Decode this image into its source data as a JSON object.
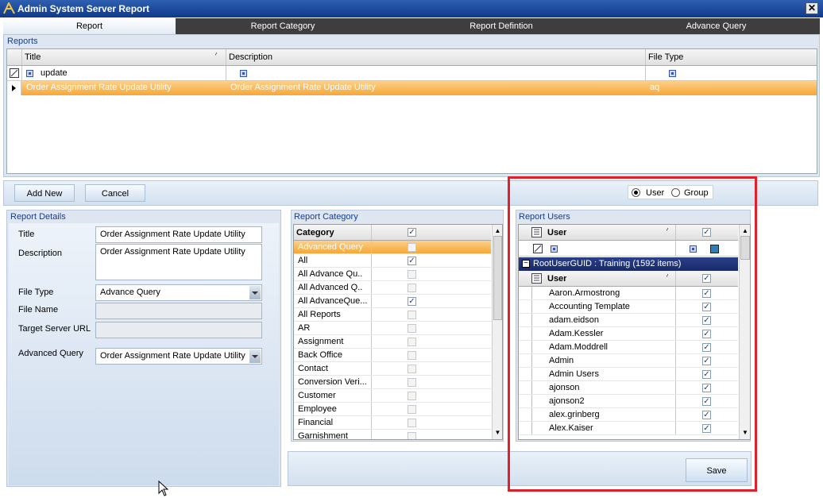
{
  "window": {
    "title": "Admin System Server Report",
    "close_glyph": "✕"
  },
  "tabs": [
    "Report",
    "Report Category",
    "Report Defintion",
    "Advance Query"
  ],
  "reports": {
    "section_title": "Reports",
    "columns": [
      "Title",
      "Description",
      "File Type"
    ],
    "filter_row": {
      "title": "update",
      "description": "",
      "file_type": ""
    },
    "rows": [
      {
        "title": "Order Assignment Rate Update Utility",
        "description": "Order Assignment Rate Update Utility",
        "file_type": "aq"
      }
    ]
  },
  "toolbar": {
    "add_new": "Add New",
    "cancel": "Cancel"
  },
  "mode": {
    "user_label": "User",
    "group_label": "Group",
    "selected": "User"
  },
  "report_details": {
    "section_title": "Report Details",
    "title_label": "Title",
    "title_value": "Order Assignment Rate Update Utility",
    "description_label": "Description",
    "description_value": "Order Assignment Rate Update Utility",
    "file_type_label": "File Type",
    "file_type_value": "Advance Query",
    "file_name_label": "File Name",
    "file_name_value": "",
    "target_url_label": "Target Server URL",
    "target_url_value": "",
    "advanced_query_label": "Advanced Query",
    "advanced_query_value": "Order Assignment Rate Update Utility"
  },
  "report_category": {
    "section_title": "Report Category",
    "column": "Category",
    "items": [
      {
        "name": "Advanced Query",
        "checked": false,
        "selected": true
      },
      {
        "name": "All",
        "checked": true
      },
      {
        "name": "All Advance Qu..",
        "checked": false
      },
      {
        "name": "All Advanced Q..",
        "checked": false
      },
      {
        "name": "All AdvanceQue...",
        "checked": true
      },
      {
        "name": "All Reports",
        "checked": false
      },
      {
        "name": "AR",
        "checked": false
      },
      {
        "name": "Assignment",
        "checked": false
      },
      {
        "name": "Back Office",
        "checked": false
      },
      {
        "name": "Contact",
        "checked": false
      },
      {
        "name": "Conversion Veri...",
        "checked": false
      },
      {
        "name": "Customer",
        "checked": false
      },
      {
        "name": "Employee",
        "checked": false
      },
      {
        "name": "Financial",
        "checked": false
      },
      {
        "name": "Garnishment",
        "checked": false
      }
    ]
  },
  "report_users": {
    "section_title": "Report Users",
    "column": "User",
    "group_header": "RootUserGUID : Training (1592 items)",
    "users": [
      "Aaron.Armostrong",
      "Accounting Template",
      "adam.eidson",
      "Adam.Kessler",
      "Adam.Moddrell",
      "Admin",
      "Admin Users",
      "ajonson",
      "ajonson2",
      "alex.grinberg",
      "Alex.Kaiser"
    ]
  },
  "save_label": "Save"
}
